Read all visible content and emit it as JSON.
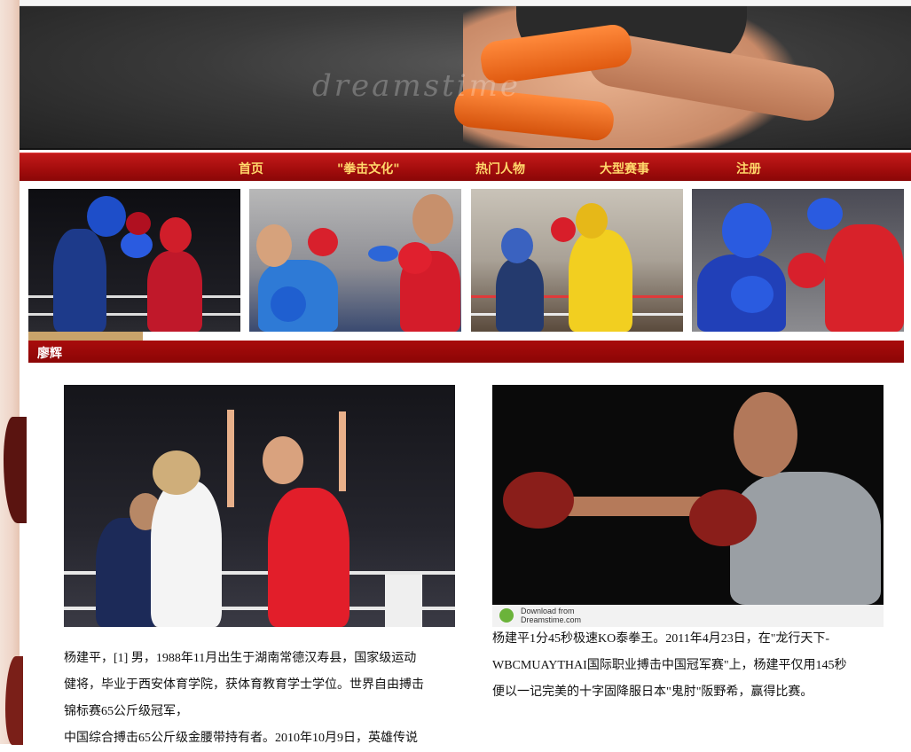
{
  "nav": {
    "items": [
      "首页",
      "\"拳击文化\"",
      "热门人物",
      "大型赛事",
      "注册"
    ]
  },
  "banner": {
    "watermark": "dreamstime"
  },
  "section": {
    "title": "廖辉"
  },
  "photo_right_footer": {
    "download": "Download from",
    "site": "Dreamstime.com",
    "watermark": "dreamstime"
  },
  "captions": {
    "left": [
      "杨建平，[1] 男，1988年11月出生于湖南常德汉寿县，国家级运动",
      "健将，毕业于西安体育学院，获体育教育学士学位。世界自由搏击",
      "锦标赛65公斤级冠军，",
      "中国综合搏击65公斤级金腰带持有者。2010年10月9日，英雄传说"
    ],
    "right": [
      "杨建平1分45秒极速KO泰拳王。2011年4月23日，在\"龙行天下-",
      "WBCMUAYTHAI国际职业搏击中国冠军赛\"上，杨建平仅用145秒",
      "便以一记完美的十字固降服日本\"鬼肘\"阪野希，赢得比赛。"
    ]
  },
  "colors": {
    "nav_bg": "#a50d0d",
    "nav_text": "#ffd86b",
    "section_bg": "#8c0505",
    "text": "#111111"
  }
}
